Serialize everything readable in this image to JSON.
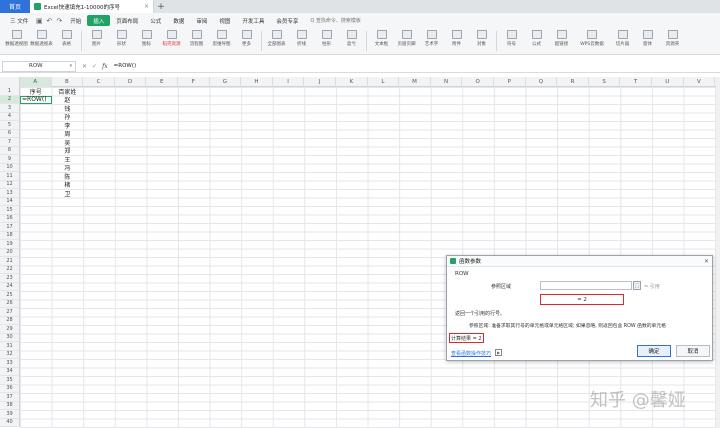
{
  "titlebar": {
    "home_tab": "首页",
    "doc_tab": "Excel快速填充1-10000的序号",
    "new_tab": "+"
  },
  "menubar": {
    "file": "三 文件",
    "items": [
      "开始",
      "插入",
      "页面布局",
      "公式",
      "数据",
      "审阅",
      "视图",
      "开发工具",
      "会员专享"
    ],
    "active": "插入",
    "search": "Q 查找命令、搜索模板"
  },
  "ribbon": {
    "buttons": [
      "数据透视图",
      "数据透视表",
      "表格",
      "图片",
      "形状",
      "图标",
      "稻壳资源",
      "流程图",
      "思维导图",
      "更多",
      "全部图表",
      "折线",
      "柱形",
      "盈亏",
      "文本框",
      "页眉页脚",
      "艺术字",
      "附件",
      "对象",
      "符号",
      "公式",
      "超链接",
      "WPS云数据",
      "切片器",
      "窗体",
      "资源夹"
    ],
    "highlight": "稻壳资源"
  },
  "formulabar": {
    "name_box": "ROW",
    "formula": "=ROW()"
  },
  "grid": {
    "columns": [
      "A",
      "B",
      "C",
      "D",
      "E",
      "F",
      "G",
      "H",
      "I",
      "J",
      "K",
      "L",
      "M",
      "N",
      "O",
      "P",
      "Q",
      "R",
      "S",
      "T",
      "U",
      "V"
    ],
    "rows": [
      "1",
      "2",
      "3",
      "4",
      "5",
      "6",
      "7",
      "8",
      "9",
      "10",
      "11",
      "12",
      "13",
      "14",
      "15",
      "16",
      "17",
      "18",
      "19",
      "20",
      "21",
      "22",
      "23",
      "24",
      "25",
      "26",
      "27",
      "28",
      "29",
      "30",
      "31",
      "32",
      "33",
      "34",
      "35",
      "36",
      "37",
      "38",
      "39",
      "40"
    ],
    "selected_col": "A",
    "selected_row": "2",
    "a1": "序号",
    "a2": "=ROW()",
    "b_col": [
      "百家姓",
      "赵",
      "钱",
      "孙",
      "李",
      "周",
      "吴",
      "郑",
      "王",
      "冯",
      "陈",
      "楮",
      "卫"
    ]
  },
  "dialog": {
    "title": "函数参数",
    "function_name": "ROW",
    "arg_label": "参照区域",
    "arg_hint": "= 引用",
    "result": "= 2",
    "desc1": "返回一个引用的行号。",
    "desc2": "参照区域: 准备求取其行号的单元格或单元格区域; 如果忽略, 则返回包含 ROW 函数的单元格",
    "calc_result": "计算结果 = 2",
    "help_link": "查看函数操作技巧",
    "ok": "确定",
    "cancel": "取消"
  },
  "watermark": "知乎 @馨娅"
}
